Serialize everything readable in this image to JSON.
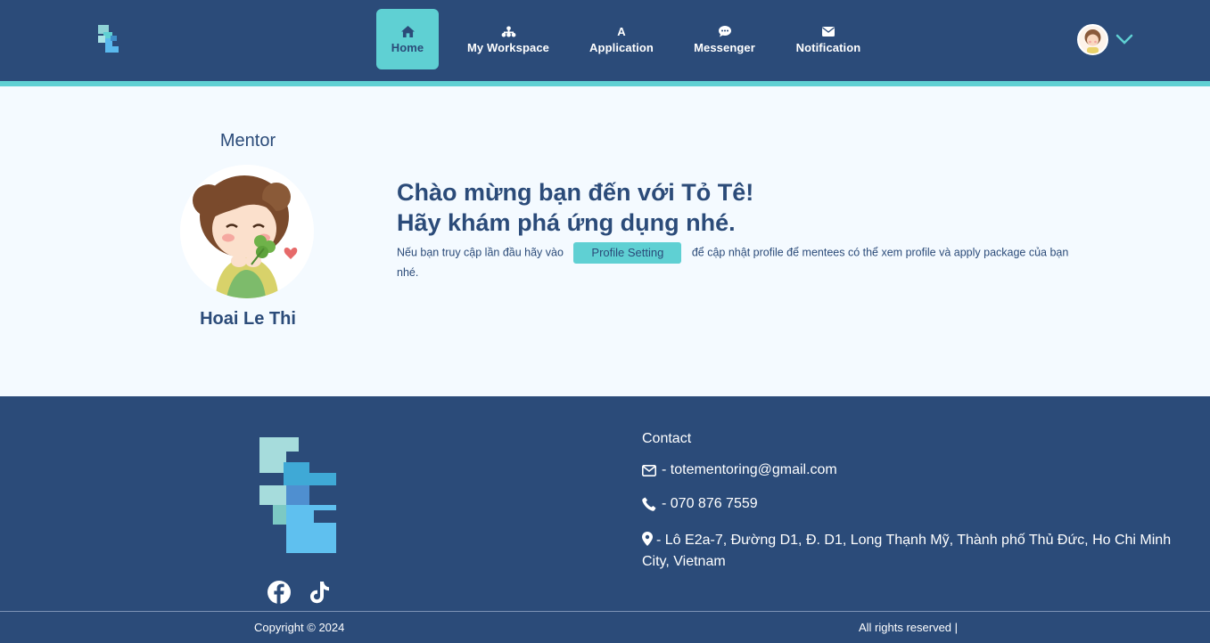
{
  "header": {
    "logo": "tote-logo",
    "nav": [
      {
        "label": "Home",
        "icon": "home-icon",
        "active": true
      },
      {
        "label": "My Workspace",
        "icon": "workspace-icon",
        "active": false
      },
      {
        "label": "Application",
        "icon": "letter-a-icon",
        "icon_text": "A",
        "active": false
      },
      {
        "label": "Messenger",
        "icon": "chat-icon",
        "active": false
      },
      {
        "label": "Notification",
        "icon": "envelope-icon",
        "active": false
      }
    ],
    "user_menu_icon": "chevron-down-icon"
  },
  "main": {
    "role": "Mentor",
    "name": "Hoai Le Thi",
    "welcome_line1": "Chào mừng bạn đến với Tỏ Tê!",
    "welcome_line2": "Hãy khám phá ứng dụng nhé.",
    "intro_before": "Nếu bạn truy cập lần đầu hãy vào",
    "profile_button": "Profile Setting",
    "intro_after": "để cập nhật profile để mentees có thể xem profile và apply package của bạn nhé."
  },
  "footer": {
    "contact_title": "Contact",
    "email": "- totementoring@gmail.com",
    "phone": "- 070 876 7559",
    "address": "- Lô E2a-7, Đường D1, Đ. D1, Long Thạnh Mỹ, Thành phố Thủ Đức, Ho Chi Minh City, Vietnam",
    "copyright": "Copyright © 2024",
    "rights": "All rights reserved |"
  },
  "colors": {
    "navy": "#2b4b79",
    "accent": "#5fd0d3",
    "background": "#f4faff"
  }
}
